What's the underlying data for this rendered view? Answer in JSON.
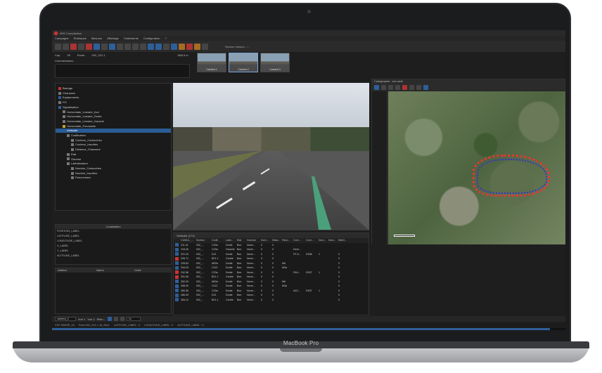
{
  "laptop": {
    "brand": "MacBook Pro"
  },
  "app": {
    "title": "IRIS Consultation"
  },
  "menu": [
    "Campagne",
    "Rubriques",
    "Mesures",
    "Affichage",
    "Traitements",
    "Configuration",
    "?"
  ],
  "toolbar": {
    "service_label": "Service mesure : --"
  },
  "info": {
    "cap_label": "Cap",
    "cap_value": "36",
    "route_label": "Route",
    "route_value": "002_021-1",
    "pr_value": "18613 m",
    "sens_value": "Sens 0"
  },
  "comment_label": "Commentaires :",
  "cameras": [
    {
      "label": "Camera 1"
    },
    {
      "label": "Camera 2"
    },
    {
      "label": "Camera 3"
    }
  ],
  "tree": [
    {
      "label": "Barrage",
      "indent": 0,
      "icon": "red"
    },
    {
      "label": "Chaussee",
      "indent": 0,
      "icon": "grey"
    },
    {
      "label": "Equipements",
      "indent": 0,
      "icon": "blue"
    },
    {
      "label": "PO",
      "indent": 0,
      "icon": "grey"
    },
    {
      "label": "Signalisation",
      "indent": 0,
      "icon": "blue"
    },
    {
      "label": "Horizontale_Lineaire_Axe",
      "indent": 1,
      "icon": "grey"
    },
    {
      "label": "Horizontale_Lineaire_Droite",
      "indent": 1,
      "icon": "grey"
    },
    {
      "label": "Horizontale_Lineaire_Gauche",
      "indent": 1,
      "icon": "grey"
    },
    {
      "label": "Horizontale_Ponctuelle",
      "indent": 1,
      "icon": "yel"
    },
    {
      "label": "Verticale",
      "indent": 1,
      "icon": "blue",
      "selected": true
    },
    {
      "label": "Codification",
      "indent": 2,
      "icon": "grey"
    },
    {
      "label": "Contenu_Cartouches",
      "indent": 3,
      "icon": "grey"
    },
    {
      "label": "Contenu_Inscrites",
      "indent": 3,
      "icon": "grey"
    },
    {
      "label": "Distance_Chaussee",
      "indent": 3,
      "icon": "grey"
    },
    {
      "label": "Etat",
      "indent": 2,
      "icon": "grey"
    },
    {
      "label": "Gamme",
      "indent": 2,
      "icon": "grey"
    },
    {
      "label": "Latéralisation",
      "indent": 2,
      "icon": "grey"
    },
    {
      "label": "Nombre_Cartouches",
      "indent": 3,
      "icon": "grey"
    },
    {
      "label": "Nombre_Inscrites",
      "indent": 3,
      "icon": "grey"
    },
    {
      "label": "Panonceaux",
      "indent": 3,
      "icon": "grey"
    }
  ],
  "location": {
    "title": "Localisation",
    "rows": [
      "POSITION_LABEL",
      "LATITUDE_LABEL",
      "LONGITUDE_LABEL",
      "X_LABEL",
      "Y_LABEL",
      "ALTITUDE_LABEL"
    ]
  },
  "attributes": {
    "columns": [
      "Attribut",
      "Valeur",
      "Unité"
    ]
  },
  "map": {
    "title": "Cartographie - vue carte"
  },
  "table": {
    "title": "Verticale (172)",
    "columns": [
      "",
      "CUMUL_...",
      "Section",
      "Codif...",
      "Later...",
      "Etat",
      "Gamme",
      "Nom...",
      "Dista...",
      "Pano...",
      "Cont...",
      "Cont...",
      "Nom...",
      "Nom...",
      "IMAG..."
    ],
    "rows": [
      [
        "b",
        "211.41",
        "002_...",
        "C20a",
        "Droite",
        "Bon",
        "Norm...",
        "0",
        "0",
        "",
        "",
        "",
        "",
        "",
        ""
      ],
      [
        "b",
        "218.26",
        "002_...",
        "C20a",
        "Gauche",
        "Bon",
        "Norm...",
        "0",
        "0",
        "",
        "Dent...",
        "",
        "",
        "",
        ""
      ],
      [
        "b",
        "221.20",
        "002_...",
        "D21",
        "Droite",
        "Bon",
        "Norm...",
        "0",
        "0",
        "",
        "ST A...",
        "D938",
        "1",
        "",
        "0"
      ],
      [
        "r",
        "226.71",
        "002_...",
        "B21-1",
        "Centre",
        "Bon",
        "Norm...",
        "0",
        "0",
        "",
        "",
        "",
        "",
        "",
        "0"
      ],
      [
        "b",
        "228.63",
        "002_...",
        "AB3a",
        "Droite",
        "Bon",
        "Norm...",
        "0",
        "0",
        "M6",
        "",
        "",
        "",
        "",
        "0"
      ],
      [
        "b",
        "234.03",
        "002_...",
        "C110",
        "Droite",
        "Bon",
        "Norm...",
        "0",
        "0",
        "M3a",
        "",
        "",
        "",
        "",
        "0"
      ],
      [
        "r",
        "242.56",
        "002_...",
        "C20a",
        "Droite",
        "Bon",
        "Norm...",
        "0",
        "0",
        "",
        "FAU...",
        "D937",
        "1",
        "",
        "0"
      ],
      [
        "r",
        "251.06",
        "002_...",
        "B21-1",
        "Centre",
        "Bon",
        "Norm...",
        "0",
        "0",
        "",
        "",
        "",
        "",
        "",
        "0"
      ],
      [
        "b",
        "252.00",
        "002_...",
        "AB3a",
        "Droite",
        "Bon",
        "Norm...",
        "0",
        "0",
        "M6",
        "",
        "",
        "",
        "",
        "0"
      ],
      [
        "b",
        "258.00",
        "002_...",
        "C112",
        "Droite",
        "Bon",
        "Norm...",
        "0",
        "0",
        "M3a",
        "",
        "",
        "",
        "",
        "0"
      ],
      [
        "b",
        "280.59",
        "002_...",
        "C20a",
        "Droite",
        "Bon",
        "Norm...",
        "0",
        "0",
        "",
        "AZ2...",
        "D937",
        "1",
        "",
        "0"
      ],
      [
        "b",
        "286.39",
        "002_...",
        "D21",
        "Droite",
        "Bon",
        "Norm...",
        "0",
        "0",
        "",
        "",
        "",
        "",
        "",
        "0"
      ],
      [
        "b",
        "306.12",
        "002_...",
        "B21-1",
        "Centre",
        "Bon",
        "Norm...",
        "0",
        "0",
        "",
        "",
        "",
        "",
        "",
        "0"
      ]
    ]
  },
  "bottombar": {
    "camera": "camera_2",
    "vue1": "Vue 1",
    "vue2": "Vue 2",
    "plein": "Plein...",
    "zoom": "1x"
  },
  "statusbar": [
    "XSX SIMISE_04",
    "Pearl 002_021-1 18_Sect.",
    "LATITUDE_LABEL : 0",
    "LONGITUDE_LABEL : 0",
    "ALTITUDE_LABEL : 0"
  ],
  "progress": 0.97
}
